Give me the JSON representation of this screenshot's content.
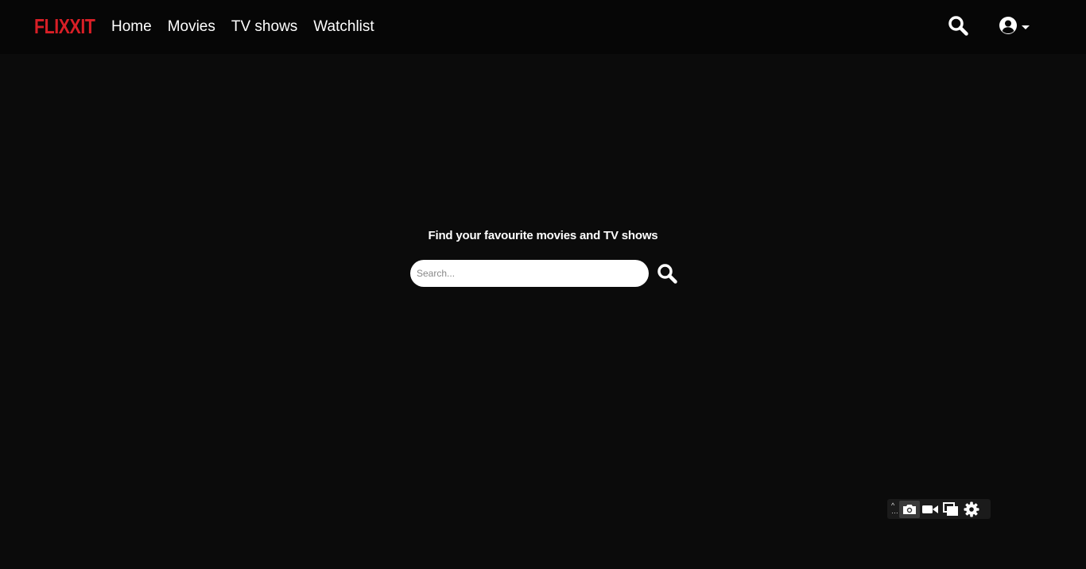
{
  "brand": {
    "logo_text": "FLIXXIT",
    "logo_color": "#d81f26"
  },
  "nav": {
    "items": [
      {
        "label": "Home"
      },
      {
        "label": "Movies"
      },
      {
        "label": "TV shows"
      },
      {
        "label": "Watchlist"
      }
    ]
  },
  "header_icons": {
    "search": "search-icon",
    "account": "user-circle-icon",
    "account_caret": "caret-down-icon"
  },
  "hero": {
    "title": "Find your favourite movies and TV shows",
    "search_placeholder": "Search...",
    "search_value": ""
  },
  "overlay_toolbar": {
    "icons": [
      "more-icon",
      "camera-icon",
      "video-camera-icon",
      "copy-window-icon",
      "gear-icon"
    ]
  },
  "colors": {
    "background": "#0b0b0b",
    "header": "#060606",
    "accent": "#d81f26"
  }
}
